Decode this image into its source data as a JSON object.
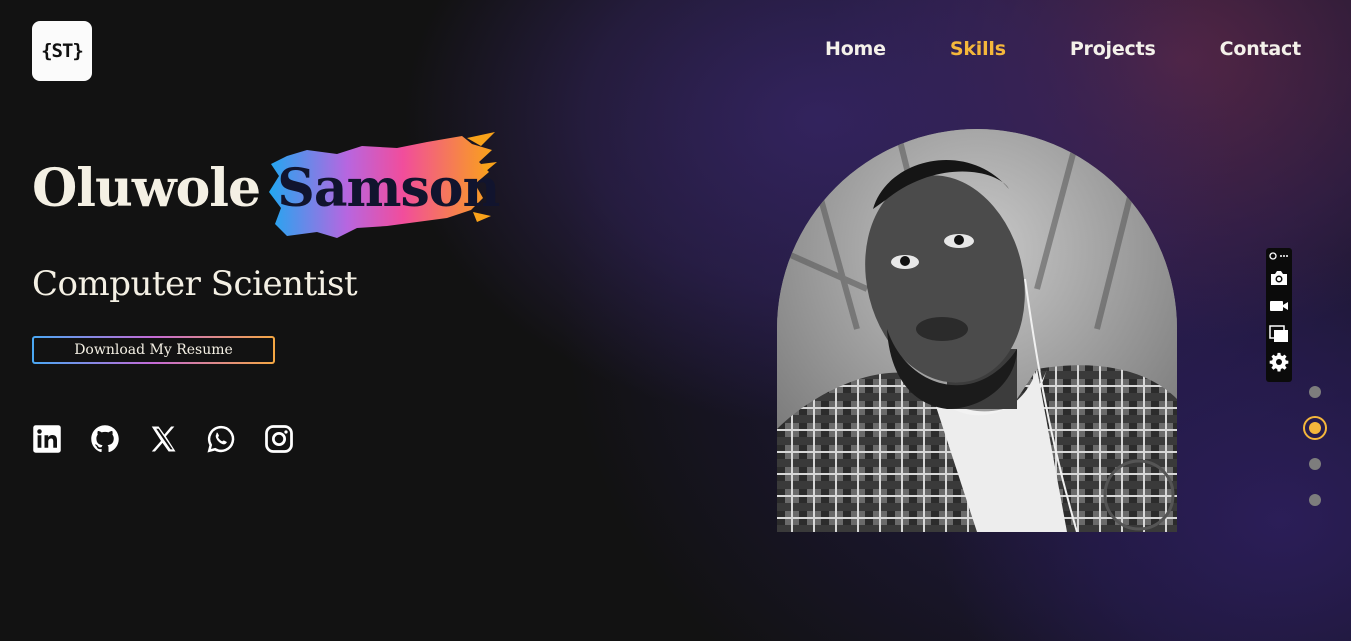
{
  "logo": {
    "text": "{ST}",
    "icon": "st-logo-icon"
  },
  "nav": {
    "items": [
      {
        "label": "Home",
        "active": false
      },
      {
        "label": "Skills",
        "active": true
      },
      {
        "label": "Projects",
        "active": false
      },
      {
        "label": "Contact",
        "active": false
      }
    ]
  },
  "hero": {
    "first_name": "Oluwole",
    "last_name": "Samson",
    "role": "Computer Scientist",
    "resume_button": "Download My Resume"
  },
  "socials": [
    "linkedin-icon",
    "github-icon",
    "x-twitter-icon",
    "whatsapp-icon",
    "instagram-icon"
  ],
  "capture_toolbar": [
    "pin-icon",
    "more-icon",
    "camera-icon",
    "video-camera-icon",
    "windows-icon",
    "gear-icon"
  ],
  "pagination": {
    "count": 4,
    "active_index": 1
  },
  "colors": {
    "accent": "#f5b73b",
    "background": "#121212",
    "text": "#f4f0e4"
  }
}
